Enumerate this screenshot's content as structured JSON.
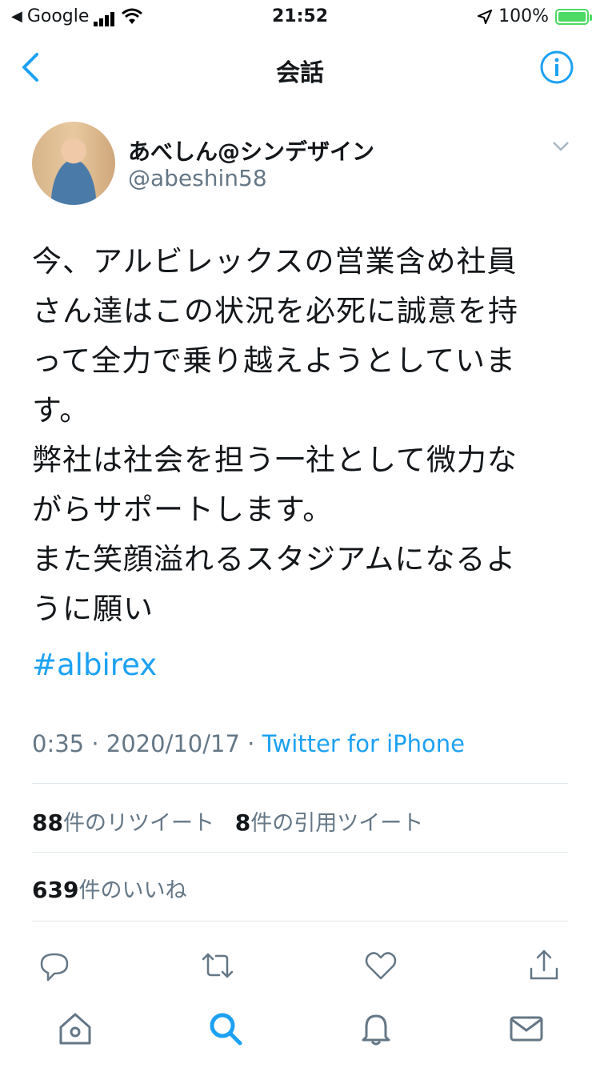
{
  "status_bar": {
    "carrier": "Google",
    "time": "21:52",
    "battery": "100%"
  },
  "nav": {
    "title": "会話"
  },
  "author": {
    "name": "あべしん@シンデザイン",
    "handle": "@abeshin58"
  },
  "tweet": {
    "text": "今、アルビレックスの営業含め社員\nさん達はこの状況を必死に誠意を持\nって全力で乗り越えようとしていま\nす。\n弊社は社会を担う一社として微力な\nがらサポートします。\nまた笑顔溢れるスタジアムになるよ\nうに願い",
    "hashtag": "#albirex",
    "time": "0:35",
    "date": "2020/10/17",
    "source": "Twitter for iPhone"
  },
  "stats": {
    "retweets": "88",
    "retweets_label": "件のリツイート",
    "quotes": "8",
    "quotes_label": "件の引用ツイート",
    "likes": "639",
    "likes_label": "件のいいね"
  },
  "colors": {
    "accent": "#1da1f2",
    "secondary_text": "#657786",
    "divider": "#e1e8ed",
    "battery": "#4cd964"
  },
  "icons": {
    "actions": [
      "reply-icon",
      "retweet-icon",
      "like-icon",
      "share-icon"
    ],
    "tabs": [
      "home-icon",
      "search-icon",
      "notifications-icon",
      "messages-icon"
    ]
  }
}
